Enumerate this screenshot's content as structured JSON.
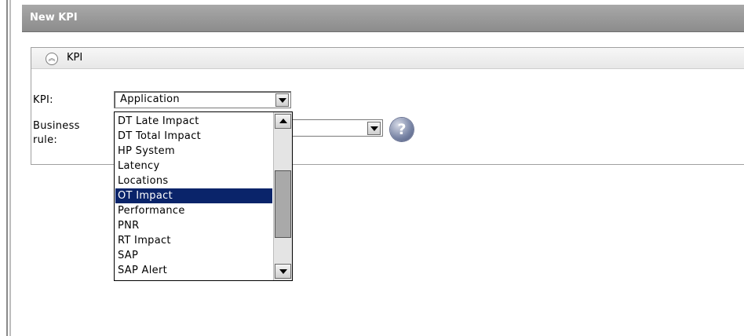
{
  "dialog": {
    "title": "New KPI"
  },
  "section": {
    "title": "KPI"
  },
  "form": {
    "kpi_label": "KPI:",
    "kpi_value": "Application",
    "business_rule_label_line1": "Business",
    "business_rule_label_line2": "rule:"
  },
  "dropdown": {
    "options": [
      "DT Late Impact",
      "DT Total Impact",
      "HP System",
      "Latency",
      "Locations",
      "OT Impact",
      "Performance",
      "PNR",
      "RT Impact",
      "SAP",
      "SAP Alert"
    ],
    "highlighted": "OT Impact"
  },
  "icons": {
    "collapse": "collapse-up-icon",
    "help": "help-icon",
    "dropdown_arrow": "chevron-down-icon"
  },
  "colors": {
    "header_bg": "#9a9a9a",
    "highlight_bg": "#0a246a",
    "highlight_text": "#ffffff"
  }
}
